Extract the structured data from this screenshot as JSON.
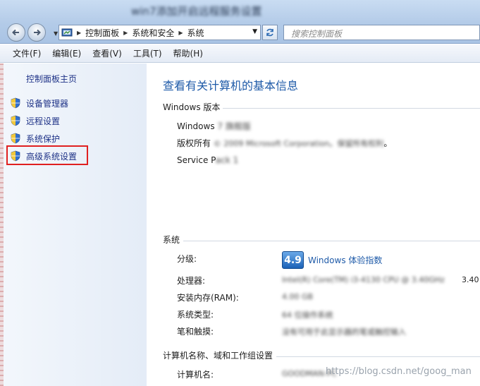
{
  "window": {
    "title": "win7添加开启远程服务设置"
  },
  "nav": {
    "breadcrumbs": [
      "控制面板",
      "系统和安全",
      "系统"
    ],
    "search_placeholder": "搜索控制面板",
    "back_icon": "back-arrow-icon",
    "forward_icon": "forward-arrow-icon",
    "refresh_icon": "refresh-icon"
  },
  "menu": {
    "items": [
      "文件(F)",
      "编辑(E)",
      "查看(V)",
      "工具(T)",
      "帮助(H)"
    ]
  },
  "sidebar": {
    "home": "控制面板主页",
    "links": [
      "设备管理器",
      "远程设置",
      "系统保护",
      "高级系统设置"
    ],
    "highlight_color": "#e02020"
  },
  "main": {
    "title": "查看有关计算机的基本信息",
    "windows_section": {
      "heading": "Windows 版本",
      "edition_label": "Windows",
      "edition_blur": "7 旗舰版",
      "copyright_label": "版权所有",
      "copyright_blur": "© 2009 Microsoft Corporation。保留所有权利",
      "copyright_end": "。",
      "sp_label": "Service P",
      "sp_blur": "ack 1"
    },
    "system_section": {
      "heading": "系统",
      "rating_label": "分级:",
      "rating_score": "4.9",
      "rating_link": "Windows 体验指数",
      "processor_label": "处理器:",
      "processor_value": "Intel(R) Core(TM) i3-4130 CPU @ 3.40GHz",
      "processor_clip": "3.40",
      "ram_label": "安装内存(RAM):",
      "ram_value": "4.00 GB",
      "type_label": "系统类型:",
      "type_value": "64 位操作系统",
      "pen_label": "笔和触摸:",
      "pen_value": "没有可用于此显示器的笔或触控输入"
    },
    "computer_section": {
      "heading": "计算机名称、域和工作组设置",
      "name_label": "计算机名:",
      "name_value": "GOODMAN-PC"
    }
  },
  "watermark": "https://blog.csdn.net/goog_man",
  "colors": {
    "link_blue": "#1e5aa8",
    "sidebar_link": "#1e3287",
    "score_blue": "#1c62b7"
  }
}
